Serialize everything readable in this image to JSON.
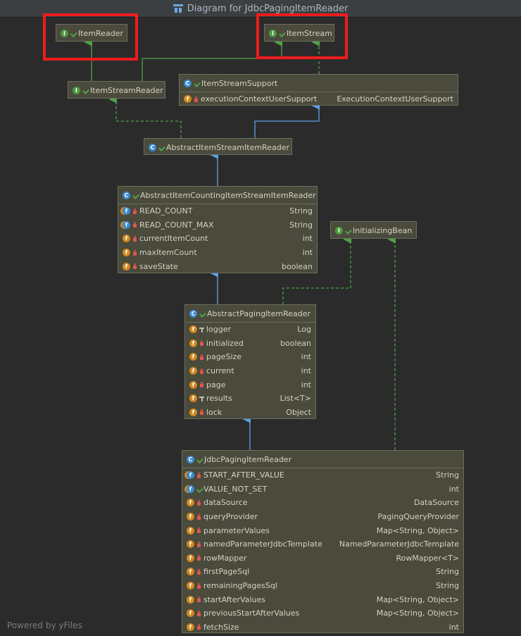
{
  "window": {
    "title": "Diagram for JdbcPagingItemReader"
  },
  "footer": {
    "text": "Powered by yFiles"
  },
  "colors": {
    "highlight": "#ee1c1c",
    "interface_icon": "#4d9a3e",
    "class_icon": "#3a8bd0",
    "field_icon": "#d08a1e",
    "implements_edge": "#4fa14a",
    "extends_edge": "#5ea3e6"
  },
  "nodes": {
    "item_reader": {
      "kind": "interface",
      "name": "ItemReader"
    },
    "item_stream": {
      "kind": "interface",
      "name": "ItemStream"
    },
    "item_stream_reader": {
      "kind": "interface",
      "name": "ItemStreamReader"
    },
    "item_stream_support": {
      "kind": "class",
      "name": "ItemStreamSupport",
      "fields": [
        {
          "name": "executionContextUserSupport",
          "type": "ExecutionContextUserSupport"
        }
      ]
    },
    "abstract_item_stream_item_reader": {
      "kind": "class",
      "name": "AbstractItemStreamItemReader"
    },
    "abstract_item_counting": {
      "kind": "class",
      "name": "AbstractItemCountingItemStreamItemReader",
      "fields": [
        {
          "name": "READ_COUNT",
          "type": "String"
        },
        {
          "name": "READ_COUNT_MAX",
          "type": "String"
        },
        {
          "name": "currentItemCount",
          "type": "int"
        },
        {
          "name": "maxItemCount",
          "type": "int"
        },
        {
          "name": "saveState",
          "type": "boolean"
        }
      ]
    },
    "initializing_bean": {
      "kind": "interface",
      "name": "InitializingBean"
    },
    "abstract_paging": {
      "kind": "class",
      "name": "AbstractPagingItemReader",
      "fields": [
        {
          "name": "logger",
          "type": "Log"
        },
        {
          "name": "initialized",
          "type": "boolean"
        },
        {
          "name": "pageSize",
          "type": "int"
        },
        {
          "name": "current",
          "type": "int"
        },
        {
          "name": "page",
          "type": "int"
        },
        {
          "name": "results",
          "type": "List<T>"
        },
        {
          "name": "lock",
          "type": "Object"
        }
      ]
    },
    "jdbc_paging": {
      "kind": "class",
      "name": "JdbcPagingItemReader",
      "fields": [
        {
          "name": "START_AFTER_VALUE",
          "type": "String"
        },
        {
          "name": "VALUE_NOT_SET",
          "type": "int"
        },
        {
          "name": "dataSource",
          "type": "DataSource"
        },
        {
          "name": "queryProvider",
          "type": "PagingQueryProvider"
        },
        {
          "name": "parameterValues",
          "type": "Map<String, Object>"
        },
        {
          "name": "namedParameterJdbcTemplate",
          "type": "NamedParameterJdbcTemplate"
        },
        {
          "name": "rowMapper",
          "type": "RowMapper<T>"
        },
        {
          "name": "firstPageSql",
          "type": "String"
        },
        {
          "name": "remainingPagesSql",
          "type": "String"
        },
        {
          "name": "startAfterValues",
          "type": "Map<String, Object>"
        },
        {
          "name": "previousStartAfterValues",
          "type": "Map<String, Object>"
        },
        {
          "name": "fetchSize",
          "type": "int"
        }
      ]
    }
  }
}
